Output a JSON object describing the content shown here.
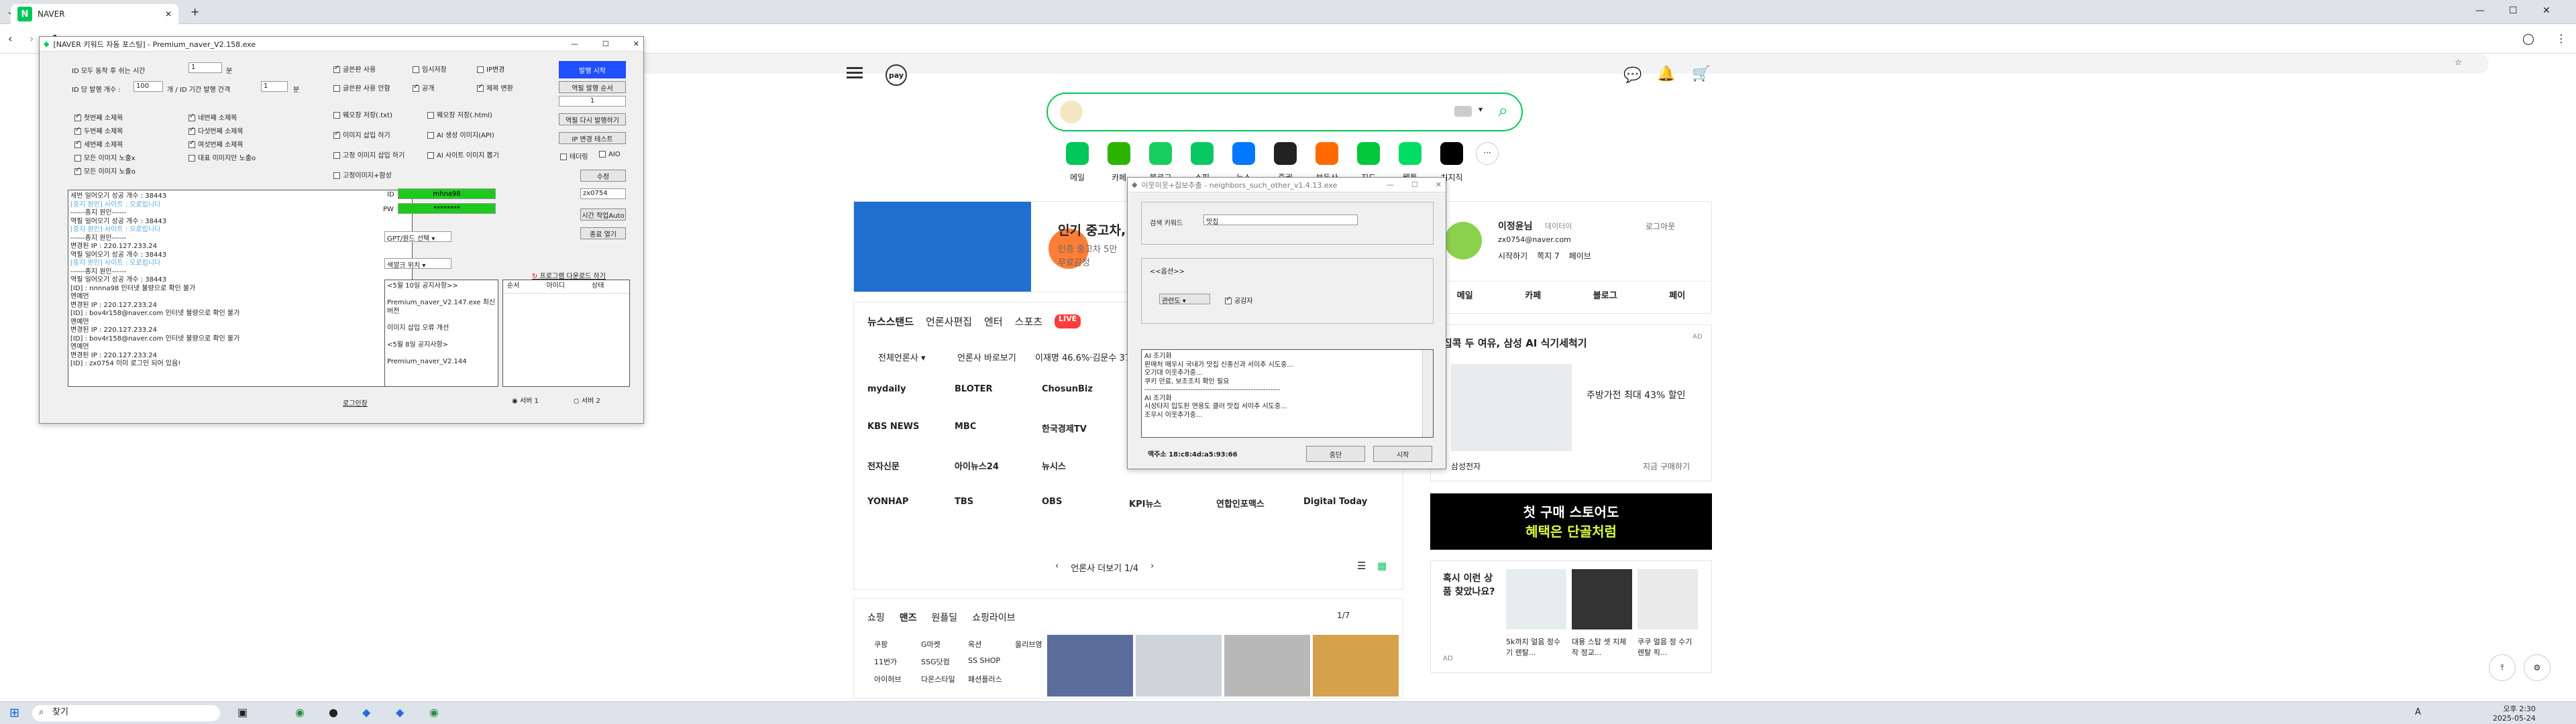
{
  "browser": {
    "tab_title": "NAVER",
    "zoom_icon": "zoom",
    "back": "‹",
    "forward": "›"
  },
  "taskbar": {
    "search": "찾기",
    "time": "오후 2:30",
    "date": "2025-05-24",
    "lang": "A"
  },
  "app": {
    "title": "[NAVER 키워드 자동 포스팅] - Premium_naver_V2.158.exe",
    "row1": {
      "label": "ID 모두 동작 후 쉬는 시간",
      "value": "1",
      "unit": "분"
    },
    "row2": {
      "label": "ID 당 발행 개수 :",
      "count": "100",
      "mid": "개 / ID 기간 발행 간격",
      "interval": "1",
      "unit": "분"
    },
    "checks_left": [
      {
        "label": "첫번째 소제목",
        "on": true
      },
      {
        "label": "네번째 소제목",
        "on": true
      },
      {
        "label": "두번째 소제목",
        "on": true
      },
      {
        "label": "다섯번째 소제목",
        "on": true
      },
      {
        "label": "세번째 소제목",
        "on": true
      },
      {
        "label": "여섯번째 소제목",
        "on": true
      },
      {
        "label": "모든 이미지 노출x",
        "on": false
      },
      {
        "label": "대표 이미지만 노출o",
        "on": false
      },
      {
        "label": "모든 이미지 노출o",
        "on": true
      }
    ],
    "checks_mid": [
      {
        "label": "글쓴판 사용",
        "on": true
      },
      {
        "label": "임시저장",
        "on": false
      },
      {
        "label": "IP변경",
        "on": false
      },
      {
        "label": "글쓴판 사용 안함",
        "on": false
      },
      {
        "label": "공개",
        "on": true
      },
      {
        "label": "제목 변환",
        "on": true
      },
      {
        "label": "웨오장 저장(.txt)",
        "on": false
      },
      {
        "label": "웨오장 저장(.html)",
        "on": false
      },
      {
        "label": "이미지 삽입 하기",
        "on": true
      },
      {
        "label": "AI 생성 이미지(API)",
        "on": false
      },
      {
        "label": "고정 이미지 삽입 하기",
        "on": false
      },
      {
        "label": "AI 사이트 이미지 뽑기",
        "on": false
      },
      {
        "label": "고정이미지+함성",
        "on": false
      }
    ],
    "right_buttons": {
      "start": "발행 시작",
      "order": "역필 발행 순서",
      "order_value": "1",
      "retry": "역필 다시 발행하기",
      "ip_test": "IP 변경 테스트",
      "tether": "테더링",
      "aio": "AIO",
      "edit": "수정",
      "code": "zx0754",
      "time_auto": "시간 작업Auto",
      "close": "종료 열기"
    },
    "log": [
      "세번 일어오기 성공 개수 : 38443",
      "[중지 원인] 사이트 : 오로립니다",
      "------종지 원인------",
      "역필 일어오기 성공 개수 : 38443",
      "[중지 원인] 사이트 : 오로립니다",
      "------종지 원인------",
      "변경된 IP : 220.127.233.24",
      "역필 일어오기 성공 개수 : 38443",
      "[중지 원인] 사이트 : 오로립니다",
      "------종지 원인------",
      "역필 일어오기 성공 개수 : 38443",
      "[ID] : nnnna98 인터넷 불량으로 확인 불가",
      "엔예먼",
      "변경된 IP : 220.127.233.24",
      "[ID] : bov4r158@naver.com 인터넷 불량으로 확인 불가",
      "엔예먼",
      "변경된 IP : 220.127.233.24",
      "[ID] : bov4r158@naver.com 인터넷 불량으로 확인 불가",
      "엔예먼",
      "변경된 IP : 220.127.233.24",
      "[ID] : zx0754 이미 로그인 되어 있음!"
    ],
    "login_btn": "로그인창",
    "id_label": "ID",
    "pw_label": "PW",
    "id_value": "mhna98",
    "pw_value": "********",
    "gpt_select": "GPT/원드 선택",
    "keyword_select": "색깔크 위치",
    "manual_link": "프로그램 다운로드 하기",
    "notices": [
      "<5월 10일 공지사항>>",
      "Premium_naver_V2.147.exe 최신버전",
      "이미지 삽입 오류 개선",
      "<5월 8일 공지사항>",
      "Premium_naver_V2.144"
    ],
    "table_headers": [
      "순서",
      "아이디",
      "상태"
    ],
    "server1": "서버 1",
    "server2": "서버 2"
  },
  "dialog": {
    "title": "이웃이웃+집보추출 - neighbors_such_other_v1.4.13.exe",
    "keyword_label": "검색 키워드",
    "keyword_value": "맛집",
    "option_label": "<<옵션>>",
    "select_value": "관련도",
    "checkbox_label": "공감자",
    "log": [
      "AI 조기화",
      "판매처 매우시 국내가 맛집 신종신과 서이추 시도중...",
      "오기대 이웃추가중...",
      "쿠키 만료, 보조조치 확인 필요",
      "--------------------------------------------------------",
      "AI 조기화",
      "시성타지 입도된 연용도 클러 맛집 서이추 시도중...",
      "조우시 이웃추가중..."
    ],
    "mac": "맥주소 18:c8:4d:a5:93:66",
    "stop": "중단",
    "start": "시작"
  },
  "naver": {
    "pay": "pay",
    "shortcuts": [
      "메일",
      "카페",
      "블로그",
      "쇼핑",
      "뉴스",
      "증권",
      "부동산",
      "지도",
      "웹툰",
      "치지직"
    ],
    "banner_title": "인기 중고차,",
    "banner_sub1": "인증 중고차 5만",
    "banner_sub2": "무료감정",
    "news_tabs": [
      "뉴스스탠드",
      "언론사편집",
      "엔터",
      "스포츠",
      "LIVE"
    ],
    "press_select": "전체언론사",
    "press_view": "언론사 바로보기",
    "headline": "이재명 46.6%·김문수 37.6%",
    "press": [
      "mydaily",
      "BLOTER",
      "ChosunBiz",
      "KBS NEWS",
      "MBC",
      "한국경제TV",
      "전자신문",
      "아이뉴스24",
      "뉴시스",
      "YONHAP",
      "TBS",
      "OBS",
      "KPI뉴스",
      "연합인포맥스",
      "Digital Today"
    ],
    "pager": "언론사 더보기 1/4",
    "shop_tabs": [
      "쇼핑",
      "맨즈",
      "원플딜",
      "쇼핑라이브"
    ],
    "shop_page": "1/7",
    "shop_list": [
      "쿠팡",
      "G마켓",
      "옥션",
      "올리브영",
      "11번가",
      "SSG닷컴",
      "SS SHOP",
      "아이허브",
      "다온스타일",
      "패션플러스"
    ],
    "user_name": "이정윤님",
    "user_badge": "데이터이",
    "logout": "로그아웃",
    "user_email": "zx0754@naver.com",
    "user_links": [
      "시작하기",
      "쪽지 7",
      "페이브"
    ],
    "user_tabs": [
      "메일",
      "카페",
      "블로그",
      "페이"
    ],
    "ad1_title": "집콕 두 여유, 삼성 AI 식기세척기",
    "ad1_text": "주방가전 최대 43% 할인",
    "ad1_brand": "삼성전자",
    "ad1_cta": "지금 구매하기",
    "ad2_line1": "첫 구매 스토어도",
    "ad2_line2": "혜택은 단골처럼",
    "rec_title": "혹시 이런 상품 찾았나요?",
    "rec_items": [
      "5k까지 얼음 정수기 렌탈...",
      "대용 스탑 셋 지체작 정교...",
      "쿠쿠 얼음 정 수기 렌탈 픽..."
    ],
    "ad_label": "AD"
  }
}
